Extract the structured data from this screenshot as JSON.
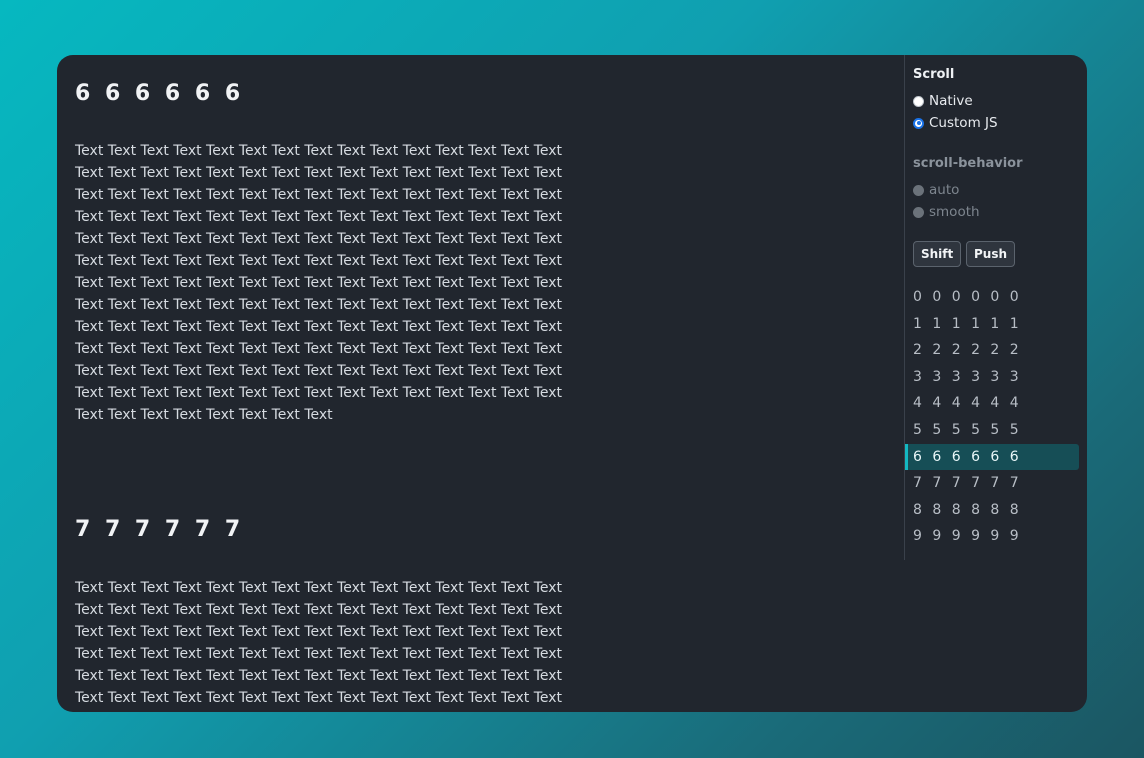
{
  "sections": [
    {
      "title": "6 6 6 6 6 6",
      "text": "Text Text Text Text Text Text Text Text Text Text Text Text Text Text Text Text Text Text Text Text Text Text Text Text Text Text Text Text Text Text Text Text Text Text Text Text Text Text Text Text Text Text Text Text Text Text Text Text Text Text Text Text Text Text Text Text Text Text Text Text Text Text Text Text Text Text Text Text Text Text Text Text Text Text Text Text Text Text Text Text Text Text Text Text Text Text Text Text Text Text Text Text Text Text Text Text Text Text Text Text Text Text Text Text Text Text Text Text Text Text Text Text Text Text Text Text Text Text Text Text Text Text Text Text Text Text Text Text Text Text Text Text Text Text Text Text Text Text Text Text Text Text Text Text Text Text Text Text Text Text Text Text Text Text Text Text Text Text Text Text Text Text Text Text Text Text Text Text Text Text Text Text Text Text Text Text Text Text Text Text Text Text Text Text Text Text Text Text"
    },
    {
      "title": "7 7 7 7 7 7",
      "text": "Text Text Text Text Text Text Text Text Text Text Text Text Text Text Text Text Text Text Text Text Text Text Text Text Text Text Text Text Text Text Text Text Text Text Text Text Text Text Text Text Text Text Text Text Text Text Text Text Text Text Text Text Text Text Text Text Text Text Text Text Text Text Text Text Text Text Text Text Text Text Text Text Text Text Text Text Text Text Text Text Text Text Text Text Text Text Text Text Text Text"
    }
  ],
  "panel": {
    "scroll_heading": "Scroll",
    "scroll_options": [
      "Native",
      "Custom JS"
    ],
    "scroll_selected": "Custom JS",
    "behavior_heading": "scroll-behavior",
    "behavior_options": [
      "auto",
      "smooth"
    ],
    "behavior_disabled": true,
    "shift_label": "Shift",
    "push_label": "Push",
    "nav_items": [
      "0 0 0 0 0 0",
      "1 1 1 1 1 1",
      "2 2 2 2 2 2",
      "3 3 3 3 3 3",
      "4 4 4 4 4 4",
      "5 5 5 5 5 5",
      "6 6 6 6 6 6",
      "7 7 7 7 7 7",
      "8 8 8 8 8 8",
      "9 9 9 9 9 9"
    ],
    "nav_active": "6 6 6 6 6 6"
  },
  "colors": {
    "accent": "#14b8c2",
    "active_bg": "#164e56",
    "window_bg": "#21262e",
    "radio_selected": "#1a73e8"
  }
}
